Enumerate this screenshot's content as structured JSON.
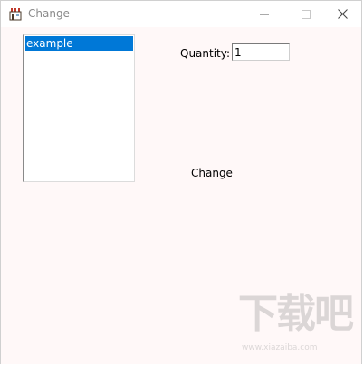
{
  "window": {
    "title": "Change",
    "icon": "shop-awning-icon",
    "controls": {
      "minimize": "minimize-icon",
      "maximize": "maximize-icon",
      "close": "close-icon"
    }
  },
  "listbox": {
    "items": [
      {
        "label": "example",
        "selected": true
      }
    ]
  },
  "quantity": {
    "label": "Quantity:",
    "value": "1"
  },
  "change": {
    "label": "Change"
  },
  "watermark": {
    "text": "下载吧",
    "subtext": "www.xiazaiba.com"
  },
  "colors": {
    "selection": "#0078d7",
    "client_background": "#fff8f8",
    "title_text": "#8a8a8a"
  }
}
